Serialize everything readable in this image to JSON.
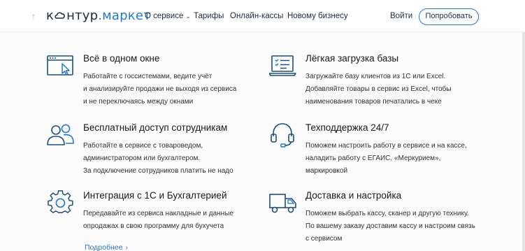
{
  "header": {
    "logo_part1": "к",
    "logo_part2": "нтур",
    "logo_part3": ".маркет",
    "nav": [
      {
        "label": "О сервисе",
        "has_dropdown": true
      },
      {
        "label": "Тарифы"
      },
      {
        "label": "Онлайн-кассы"
      },
      {
        "label": "Новому бизнесу"
      }
    ],
    "login_label": "Войти",
    "try_label": "Попробовать"
  },
  "colors": {
    "accent": "#2478c8",
    "icon": "#1f4e79",
    "text": "#222222"
  },
  "features": [
    {
      "icon": "browser-cursor-icon",
      "title": "Всё в одном окне",
      "lines": [
        "Работайте с госсистемами, ведите учёт",
        "и анализируйте продажи не выходя из сервиса",
        "и не переключаясь между окнами"
      ]
    },
    {
      "icon": "laptop-checklist-icon",
      "title": "Лёгкая загрузка базы",
      "lines": [
        "Загружайте базу клиентов из 1С или Excel.",
        "Добавляйте товары в сервис из Excel, чтобы",
        "наименования товаров печатались в чеке"
      ]
    },
    {
      "icon": "users-icon",
      "title": "Бесплатный доступ сотрудникам",
      "lines": [
        "Работайте в сервисе с товароведом,",
        "администратором или бухгалтером.",
        "За подключение сотрудников платить не надо"
      ]
    },
    {
      "icon": "headset-icon",
      "title": "Техподдержка 24/7",
      "lines": [
        "Поможем настроить работу в сервисе и на кассе,",
        "наладить работу с ЕГАИС, «Меркурием»,",
        "маркировкой"
      ]
    },
    {
      "icon": "gear-icon",
      "title": "Интеграция с 1С и Бухгалтерией",
      "lines": [
        "Передавайте из сервиса накладные и данные",
        "опродажах в свою программу для бухучета"
      ]
    },
    {
      "icon": "truck-icon",
      "title": "Доставка и настройка",
      "lines": [
        "Поможем выбрать кассу, сканер и другую технику.",
        "По вашему заказу доставим кассу и настроим связь",
        "с сервисом"
      ]
    }
  ],
  "more_link": "Подробнее"
}
